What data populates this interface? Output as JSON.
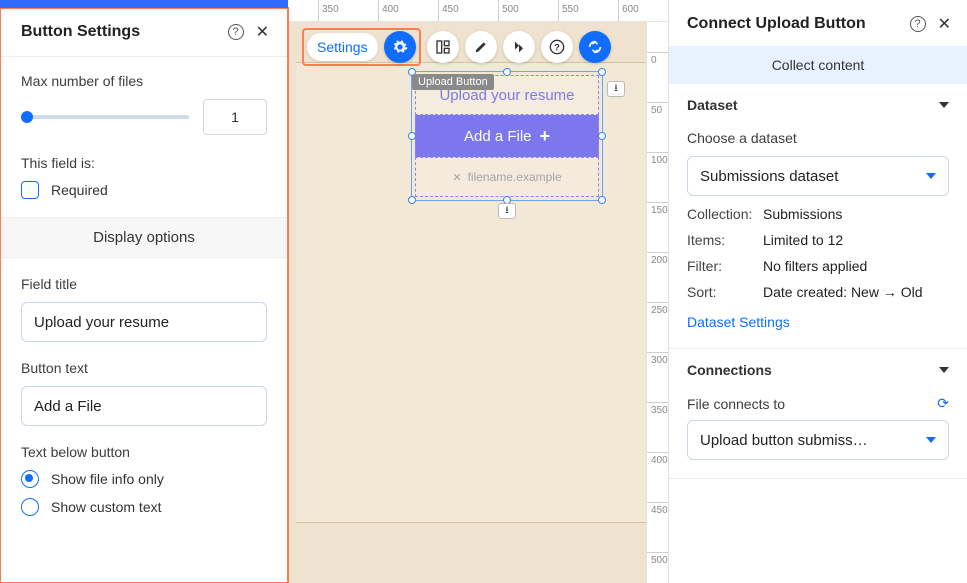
{
  "left": {
    "title": "Button Settings",
    "max_files_label": "Max number of files",
    "max_files_value": "1",
    "field_is_label": "This field is:",
    "required_label": "Required",
    "display_options": "Display options",
    "field_title_label": "Field title",
    "field_title_value": "Upload your resume",
    "button_text_label": "Button text",
    "button_text_value": "Add a File",
    "text_below_label": "Text below button",
    "radio_info": "Show file info only",
    "radio_custom": "Show custom text"
  },
  "toolbar": {
    "settings": "Settings"
  },
  "widget": {
    "label": "Upload Button",
    "title": "Upload your resume",
    "btn": "Add a File",
    "filename": "filename.example"
  },
  "ruler": {
    "h": [
      "350",
      "400",
      "450",
      "500",
      "550",
      "600"
    ],
    "v": [
      "0",
      "50",
      "100",
      "150",
      "200",
      "250",
      "300",
      "350",
      "400",
      "450",
      "500"
    ]
  },
  "right": {
    "title": "Connect Upload Button",
    "collect": "Collect content",
    "dataset_h": "Dataset",
    "choose_label": "Choose a dataset",
    "dataset_value": "Submissions dataset",
    "collection_k": "Collection:",
    "collection_v": "Submissions",
    "items_k": "Items:",
    "items_v": "Limited to 12",
    "filter_k": "Filter:",
    "filter_v": "No filters applied",
    "sort_k": "Sort:",
    "sort_v": "Date created: New → Old",
    "ds_link": "Dataset Settings",
    "connections_h": "Connections",
    "file_connects_label": "File connects to",
    "file_connects_value": "Upload button submiss…"
  }
}
